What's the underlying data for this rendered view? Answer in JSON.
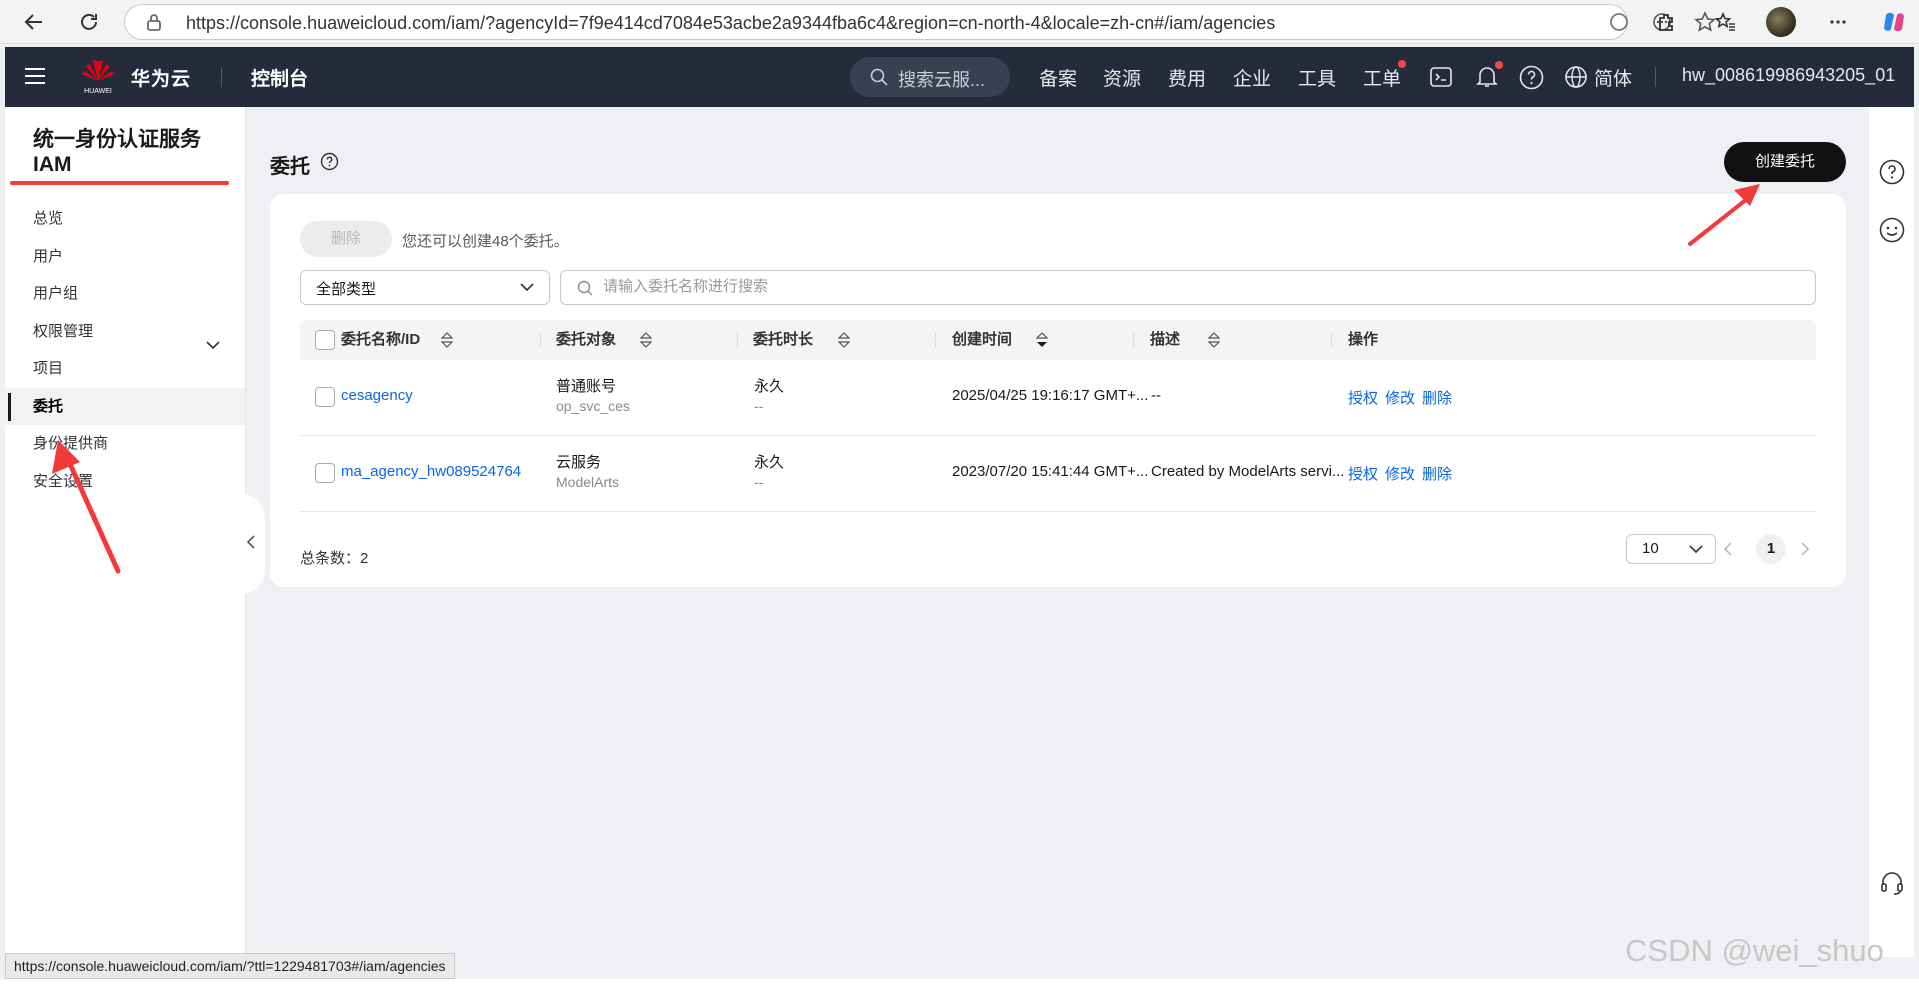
{
  "browser": {
    "url": "https://console.huaweicloud.com/iam/?agencyId=7f9e414cd7084e53acbe2a9344fba6c4&region=cn-north-4&locale=zh-cn#/iam/agencies",
    "status_url": "https://console.huaweicloud.com/iam/?ttl=1229481703#/iam/agencies"
  },
  "topnav": {
    "brand": "华为云",
    "logo_text": "HUAWEI",
    "console": "控制台",
    "search_placeholder": "搜索云服...",
    "items": [
      "备案",
      "资源",
      "费用",
      "企业",
      "工具",
      "工单"
    ],
    "language": "简体",
    "user": "hw_008619986943205_01"
  },
  "sidebar": {
    "title_line1": "统一身份认证服务",
    "title_line2": "IAM",
    "items": [
      {
        "label": "总览"
      },
      {
        "label": "用户"
      },
      {
        "label": "用户组"
      },
      {
        "label": "权限管理"
      },
      {
        "label": "项目"
      },
      {
        "label": "委托"
      },
      {
        "label": "身份提供商"
      },
      {
        "label": "安全设置"
      }
    ],
    "active": "委托"
  },
  "main": {
    "title": "委托",
    "create_button": "创建委托",
    "delete_button": "删除",
    "quota_text": "您还可以创建48个委托。",
    "type_filter": "全部类型",
    "search_placeholder": "请输入委托名称进行搜索",
    "columns": [
      "委托名称/ID",
      "委托对象",
      "委托时长",
      "创建时间",
      "描述",
      "操作"
    ],
    "rows": [
      {
        "name": "cesagency",
        "target": "普通账号",
        "target_sub": "op_svc_ces",
        "duration": "永久",
        "duration_sub": "--",
        "created": "2025/04/25 19:16:17 GMT+...",
        "description": "--",
        "actions": [
          "授权",
          "修改",
          "删除"
        ]
      },
      {
        "name": "ma_agency_hw089524764",
        "target": "云服务",
        "target_sub": "ModelArts",
        "duration": "永久",
        "duration_sub": "--",
        "created": "2023/07/20 15:41:44 GMT+...",
        "description": "Created by ModelArts servi...",
        "actions": [
          "授权",
          "修改",
          "删除"
        ]
      }
    ],
    "total_label": "总条数：",
    "total": "2",
    "page_size": "10",
    "current_page": "1"
  },
  "watermark": "CSDN @wei_shuo",
  "colors": {
    "nav_bg": "#252b3a",
    "link": "#0a65e6",
    "annotation": "#f23a3a",
    "primary_button": "#111111"
  }
}
